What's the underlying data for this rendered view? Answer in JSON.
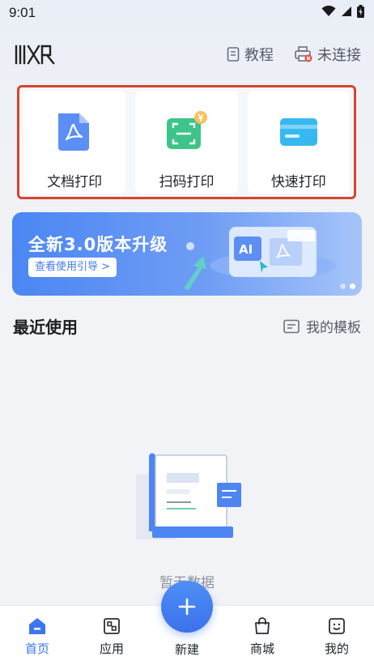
{
  "status_bar": {
    "time": "9:01"
  },
  "header": {
    "logo_text": "快印",
    "tutorial_label": "教程",
    "connection_label": "未连接"
  },
  "quick_actions": [
    {
      "label": "文档打印",
      "icon": "pdf-document-icon"
    },
    {
      "label": "扫码打印",
      "icon": "scan-code-icon"
    },
    {
      "label": "快速打印",
      "icon": "card-print-icon"
    }
  ],
  "banner": {
    "title": "全新3.0版本升级",
    "button_label": "查看使用引导 >",
    "art_badge": "AI",
    "pages": 2,
    "active_page": 2
  },
  "recent": {
    "title": "最近使用",
    "template_link": "我的模板",
    "empty_text": "暂无数据"
  },
  "bottom_nav": {
    "items": [
      {
        "label": "首页",
        "icon": "home-icon",
        "active": true
      },
      {
        "label": "应用",
        "icon": "apps-icon",
        "active": false
      },
      {
        "label": "新建",
        "icon": "plus-icon",
        "active": false
      },
      {
        "label": "商城",
        "icon": "shop-bag-icon",
        "active": false
      },
      {
        "label": "我的",
        "icon": "profile-icon",
        "active": false
      }
    ]
  },
  "colors": {
    "accent": "#3b76ef",
    "highlight_border": "#d9432f"
  }
}
